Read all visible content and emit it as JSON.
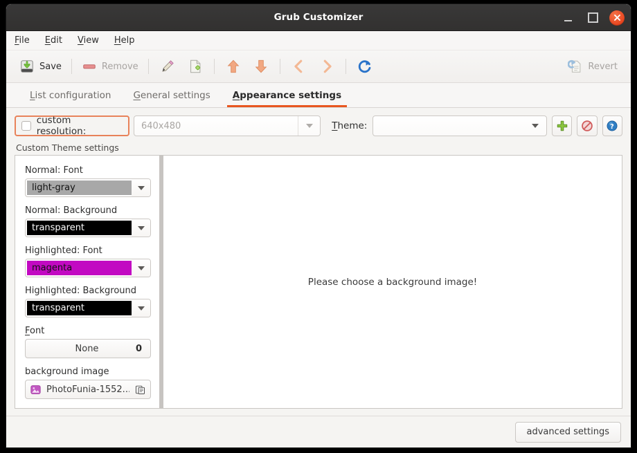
{
  "window": {
    "title": "Grub Customizer",
    "buttons": {
      "minimize": "minimize-button",
      "maximize": "maximize-button",
      "close": "close-button"
    }
  },
  "menubar": {
    "items": [
      {
        "label": "File",
        "mnemonic": "F"
      },
      {
        "label": "Edit",
        "mnemonic": "E"
      },
      {
        "label": "View",
        "mnemonic": "V"
      },
      {
        "label": "Help",
        "mnemonic": "H"
      }
    ]
  },
  "toolbar": {
    "save_label": "Save",
    "remove_label": "Remove",
    "revert_label": "Revert",
    "icons": [
      "save-icon",
      "remove-icon",
      "edit-pencil-icon",
      "new-document-icon",
      "move-up-icon",
      "move-down-icon",
      "move-left-icon",
      "move-right-icon",
      "reload-icon",
      "revert-icon"
    ]
  },
  "tabs": [
    {
      "label": "List configuration",
      "mnemonic": "L",
      "active": false
    },
    {
      "label": "General settings",
      "mnemonic": "G",
      "active": false
    },
    {
      "label": "Appearance settings",
      "mnemonic": "A",
      "active": true
    }
  ],
  "toprow": {
    "custom_resolution_label": "custom resolution:",
    "custom_resolution_checked": false,
    "resolution_value": "640x480",
    "resolution_enabled": false,
    "theme_label": "Theme:",
    "theme_mnemonic": "T",
    "theme_value": "",
    "add_theme_icon": "add-plus-icon",
    "remove_theme_icon": "forbidden-icon",
    "help_icon": "help-question-icon"
  },
  "custom_theme": {
    "group_label": "Custom Theme settings",
    "fields": [
      {
        "label": "Normal: Font",
        "value": "light-gray",
        "bg": "#a8a8a8",
        "fg": "#111111"
      },
      {
        "label": "Normal: Background",
        "value": "transparent",
        "bg": "#000000",
        "fg": "#ffffff"
      },
      {
        "label": "Highlighted: Font",
        "value": "magenta",
        "bg": "#c209c2",
        "fg": "#111111"
      },
      {
        "label": "Highlighted: Background",
        "value": "transparent",
        "bg": "#000000",
        "fg": "#ffffff"
      }
    ],
    "font": {
      "label": "Font",
      "mnemonic": "F",
      "value": "None",
      "size": "0"
    },
    "background_image": {
      "label": "background image",
      "filename": "PhotoFunia-1552...",
      "thumb_icon": "image-file-icon",
      "browse_icon": "copy-browse-icon"
    }
  },
  "preview": {
    "message": "Please choose a background image!"
  },
  "footer": {
    "advanced_settings_label": "advanced settings"
  },
  "colors": {
    "accent": "#e8561f",
    "focus_outline": "#e8825a",
    "titlebar": "#343332",
    "close_button": "#e8441d",
    "window_bg": "#f5f4f2"
  }
}
